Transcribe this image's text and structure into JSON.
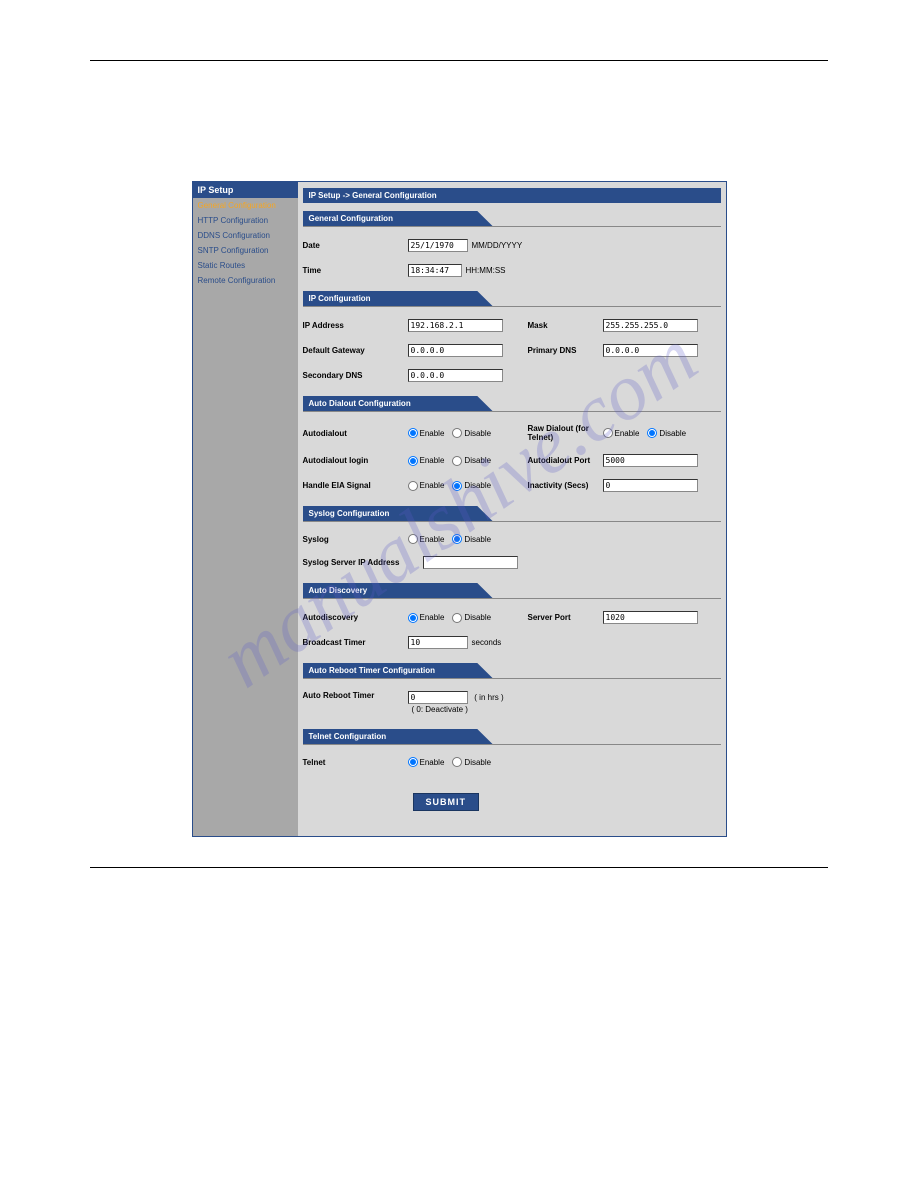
{
  "watermark": "manualshive.com",
  "sidebar": {
    "title": "IP Setup",
    "items": [
      {
        "label": "General Configuration",
        "active": true
      },
      {
        "label": "HTTP Configuration",
        "active": false
      },
      {
        "label": "DDNS Configuration",
        "active": false
      },
      {
        "label": "SNTP Configuration",
        "active": false
      },
      {
        "label": "Static Routes",
        "active": false
      },
      {
        "label": "Remote Configuration",
        "active": false
      }
    ]
  },
  "breadcrumb": "IP Setup  ->  General Configuration",
  "sections": {
    "general": {
      "title": "General Configuration",
      "date_label": "Date",
      "date_value": "25/1/1970",
      "date_hint": "MM/DD/YYYY",
      "time_label": "Time",
      "time_value": "18:34:47",
      "time_hint": "HH:MM:SS"
    },
    "ip": {
      "title": "IP Configuration",
      "ip_label": "IP Address",
      "ip_value": "192.168.2.1",
      "mask_label": "Mask",
      "mask_value": "255.255.255.0",
      "gw_label": "Default Gateway",
      "gw_value": "0.0.0.0",
      "pdns_label": "Primary DNS",
      "pdns_value": "0.0.0.0",
      "sdns_label": "Secondary DNS",
      "sdns_value": "0.0.0.0"
    },
    "dialout": {
      "title": "Auto Dialout Configuration",
      "autodialout_label": "Autodialout",
      "autodialout_value": "Enable",
      "rawdialout_label": "Raw Dialout (for Telnet)",
      "rawdialout_value": "Disable",
      "login_label": "Autodialout login",
      "login_value": "Enable",
      "port_label": "Autodialout Port",
      "port_value": "5000",
      "eia_label": "Handle EIA Signal",
      "eia_value": "Disable",
      "inactivity_label": "Inactivity (Secs)",
      "inactivity_value": "0"
    },
    "syslog": {
      "title": "Syslog Configuration",
      "syslog_label": "Syslog",
      "syslog_value": "Disable",
      "server_label": "Syslog Server IP Address",
      "server_value": ""
    },
    "discovery": {
      "title": "Auto Discovery",
      "autodisc_label": "Autodiscovery",
      "autodisc_value": "Enable",
      "serverport_label": "Server Port",
      "serverport_value": "1020",
      "timer_label": "Broadcast Timer",
      "timer_value": "10",
      "timer_hint": "seconds"
    },
    "reboot": {
      "title": "Auto Reboot Timer Configuration",
      "label": "Auto Reboot Timer",
      "value": "0",
      "hint1": "( in hrs )",
      "hint2": "( 0: Deactivate )"
    },
    "telnet": {
      "title": "Telnet Configuration",
      "label": "Telnet",
      "value": "Enable"
    }
  },
  "radio": {
    "enable": "Enable",
    "disable": "Disable"
  },
  "submit_label": "SUBMIT"
}
